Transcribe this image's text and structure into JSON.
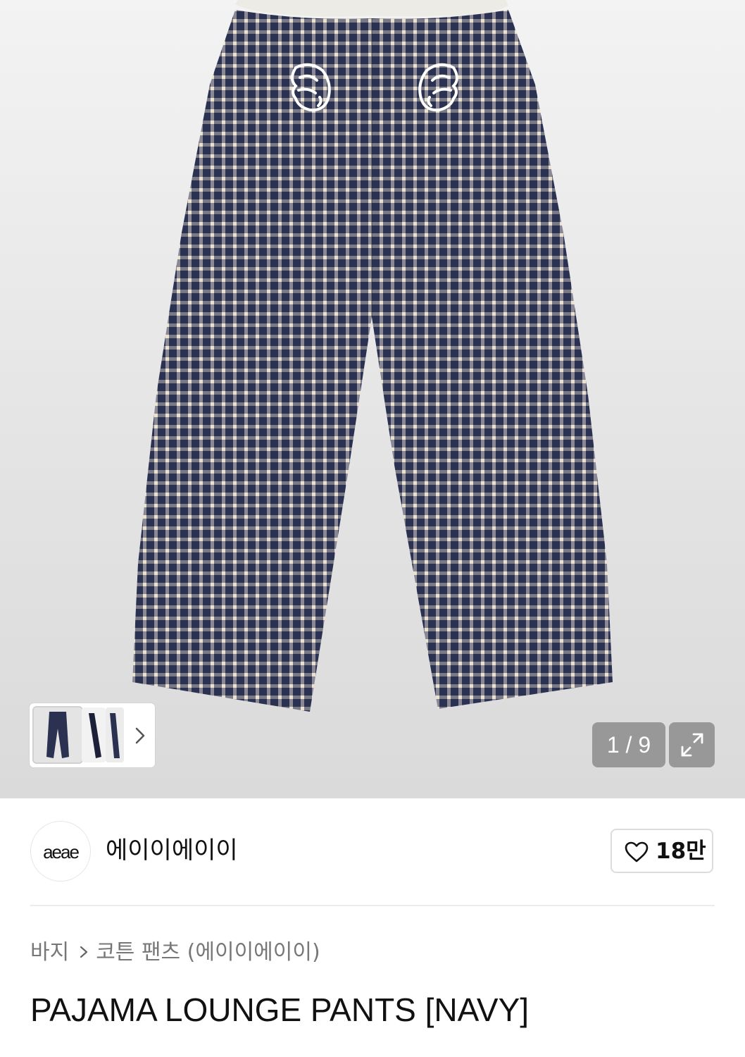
{
  "gallery": {
    "counter": "1 / 9",
    "product_image": "plaid-pants-photo",
    "thumbnails": [
      "pants-front",
      "pants-side",
      "pants-back"
    ],
    "next_icon": "chevron-right-icon",
    "expand_icon": "expand-icon"
  },
  "brand": {
    "logo_text": "aeae",
    "name": "에이이에이이"
  },
  "like": {
    "icon": "heart-icon",
    "count": "18만"
  },
  "breadcrumb": {
    "category": "바지",
    "separator_icon": "chevron-right-icon",
    "subcategory": "코튼 팬츠 (에이이에이이)"
  },
  "product": {
    "title": "PAJAMA LOUNGE PANTS [NAVY]"
  },
  "colors": {
    "navy": "#2b3150",
    "cream": "#d9d2bd",
    "waistband": "#ecebe6"
  }
}
